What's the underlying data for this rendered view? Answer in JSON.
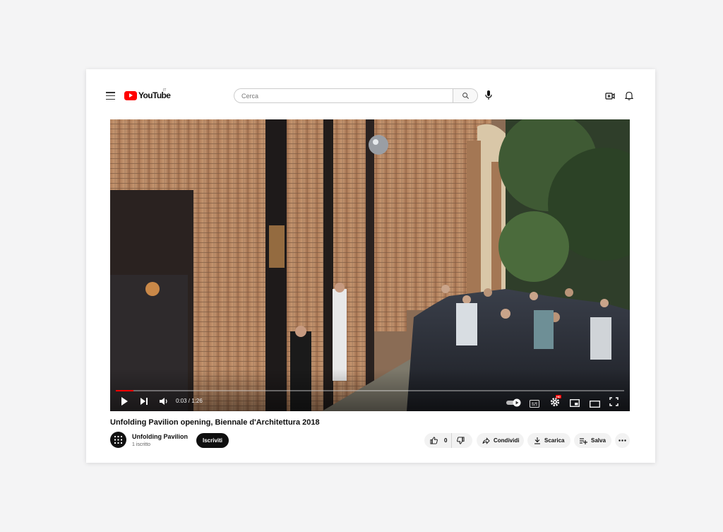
{
  "header": {
    "logo_text": "YouTube",
    "region": "IT",
    "search": {
      "placeholder": "Cerca",
      "value": ""
    }
  },
  "player": {
    "time_current": "0:03",
    "time_separator": " / ",
    "time_total": "1:26",
    "progress": 0.035,
    "hd_badge": "HD",
    "accent_color": "#ff0000"
  },
  "video": {
    "title": "Unfolding Pavilion opening, Biennale d'Architettura 2018"
  },
  "channel": {
    "name": "Unfolding Pavilion",
    "subscribers": "1 iscritto",
    "subscribe_label": "Iscriviti"
  },
  "actions": {
    "like_count": "0",
    "share_label": "Condividi",
    "download_label": "Scarica",
    "save_label": "Salva"
  },
  "icons": [
    "menu-icon",
    "youtube-logo-icon",
    "search-icon",
    "mic-icon",
    "create-video-icon",
    "bell-icon",
    "play-icon",
    "next-icon",
    "volume-icon",
    "autoplay-toggle",
    "subtitles-icon",
    "settings-icon",
    "miniplayer-icon",
    "theater-icon",
    "fullscreen-icon",
    "thumbs-up-icon",
    "thumbs-down-icon",
    "share-icon",
    "download-icon",
    "save-playlist-icon",
    "more-icon"
  ]
}
